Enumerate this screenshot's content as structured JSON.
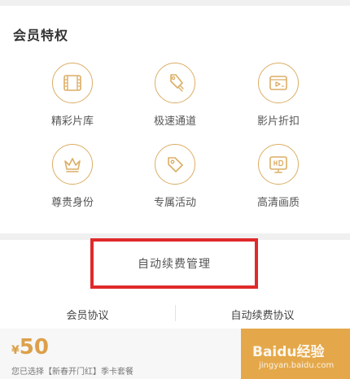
{
  "privileges": {
    "title": "会员特权",
    "items": [
      {
        "label": "精彩片库",
        "icon": "film-icon"
      },
      {
        "label": "极速通道",
        "icon": "rocket-icon"
      },
      {
        "label": "影片折扣",
        "icon": "ticket-icon"
      },
      {
        "label": "尊贵身份",
        "icon": "crown-icon"
      },
      {
        "label": "专属活动",
        "icon": "tag-icon"
      },
      {
        "label": "高清画质",
        "icon": "hd-tv-icon"
      }
    ]
  },
  "auto_renew": {
    "label": "自动续费管理"
  },
  "agreements": {
    "member": "会员协议",
    "auto_renew": "自动续费协议"
  },
  "purchase": {
    "currency": "¥",
    "price": "50",
    "selection": "您已选择【新春开门红】季卡套餐"
  },
  "watermark": {
    "brand": "Baidu经验",
    "url": "jingyan.baidu.com"
  },
  "colors": {
    "accent": "#dcae66",
    "highlight_border": "#e02a2a",
    "pay_button": "#e4a84b"
  }
}
